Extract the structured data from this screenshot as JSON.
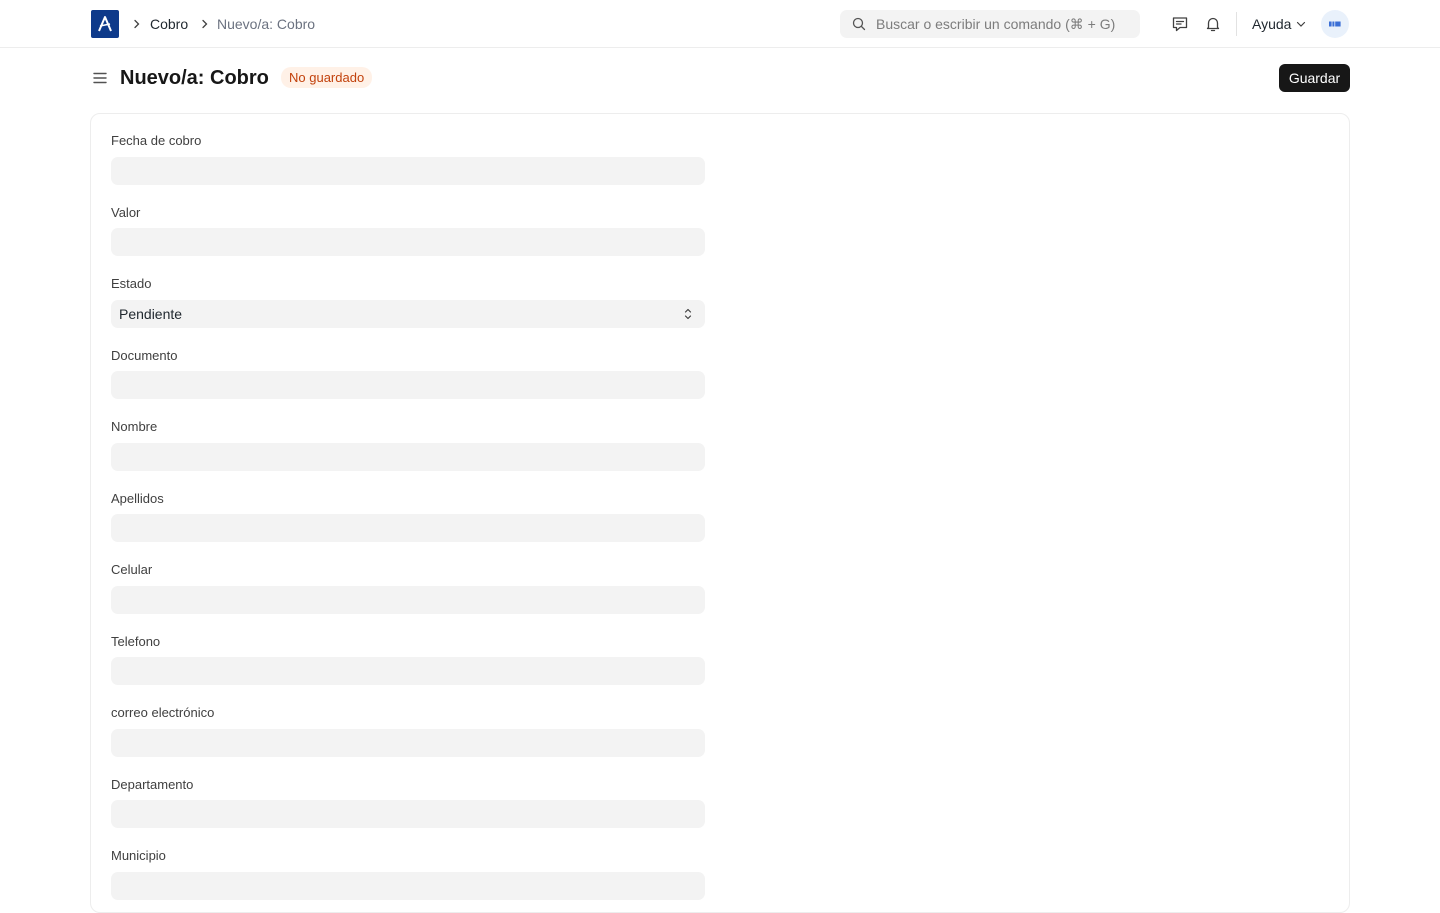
{
  "navbar": {
    "breadcrumbs": [
      {
        "label": "Cobro"
      },
      {
        "label": "Nuevo/a: Cobro"
      }
    ],
    "search": {
      "placeholder": "Buscar o escribir un comando (⌘ + G)"
    },
    "icons": {
      "logo": "app-logo-icon",
      "notifications": "bell-icon",
      "messages": "chat-icon"
    },
    "help_label": "Ayuda",
    "avatar_initials": "ᴱᴵᴬ"
  },
  "page": {
    "title": "Nuevo/a: Cobro",
    "status": "No guardado",
    "save_label": "Guardar"
  },
  "form": {
    "fields": [
      {
        "label": "Fecha de cobro",
        "value": ""
      },
      {
        "label": "Valor",
        "value": ""
      },
      {
        "label": "Estado",
        "value": "Pendiente",
        "type": "select"
      },
      {
        "label": "Documento",
        "value": ""
      },
      {
        "label": "Nombre",
        "value": ""
      },
      {
        "label": "Apellidos",
        "value": ""
      },
      {
        "label": "Celular",
        "value": ""
      },
      {
        "label": "Telefono",
        "value": ""
      },
      {
        "label": "correo electrónico",
        "value": ""
      },
      {
        "label": "Departamento",
        "value": ""
      },
      {
        "label": "Municipio",
        "value": ""
      }
    ]
  },
  "colors": {
    "logo_bg": "#0e3a8a",
    "primary_button": "#171717",
    "badge_bg": "#fff1e7",
    "badge_text": "#c2410c",
    "input_bg": "#f3f3f3"
  }
}
